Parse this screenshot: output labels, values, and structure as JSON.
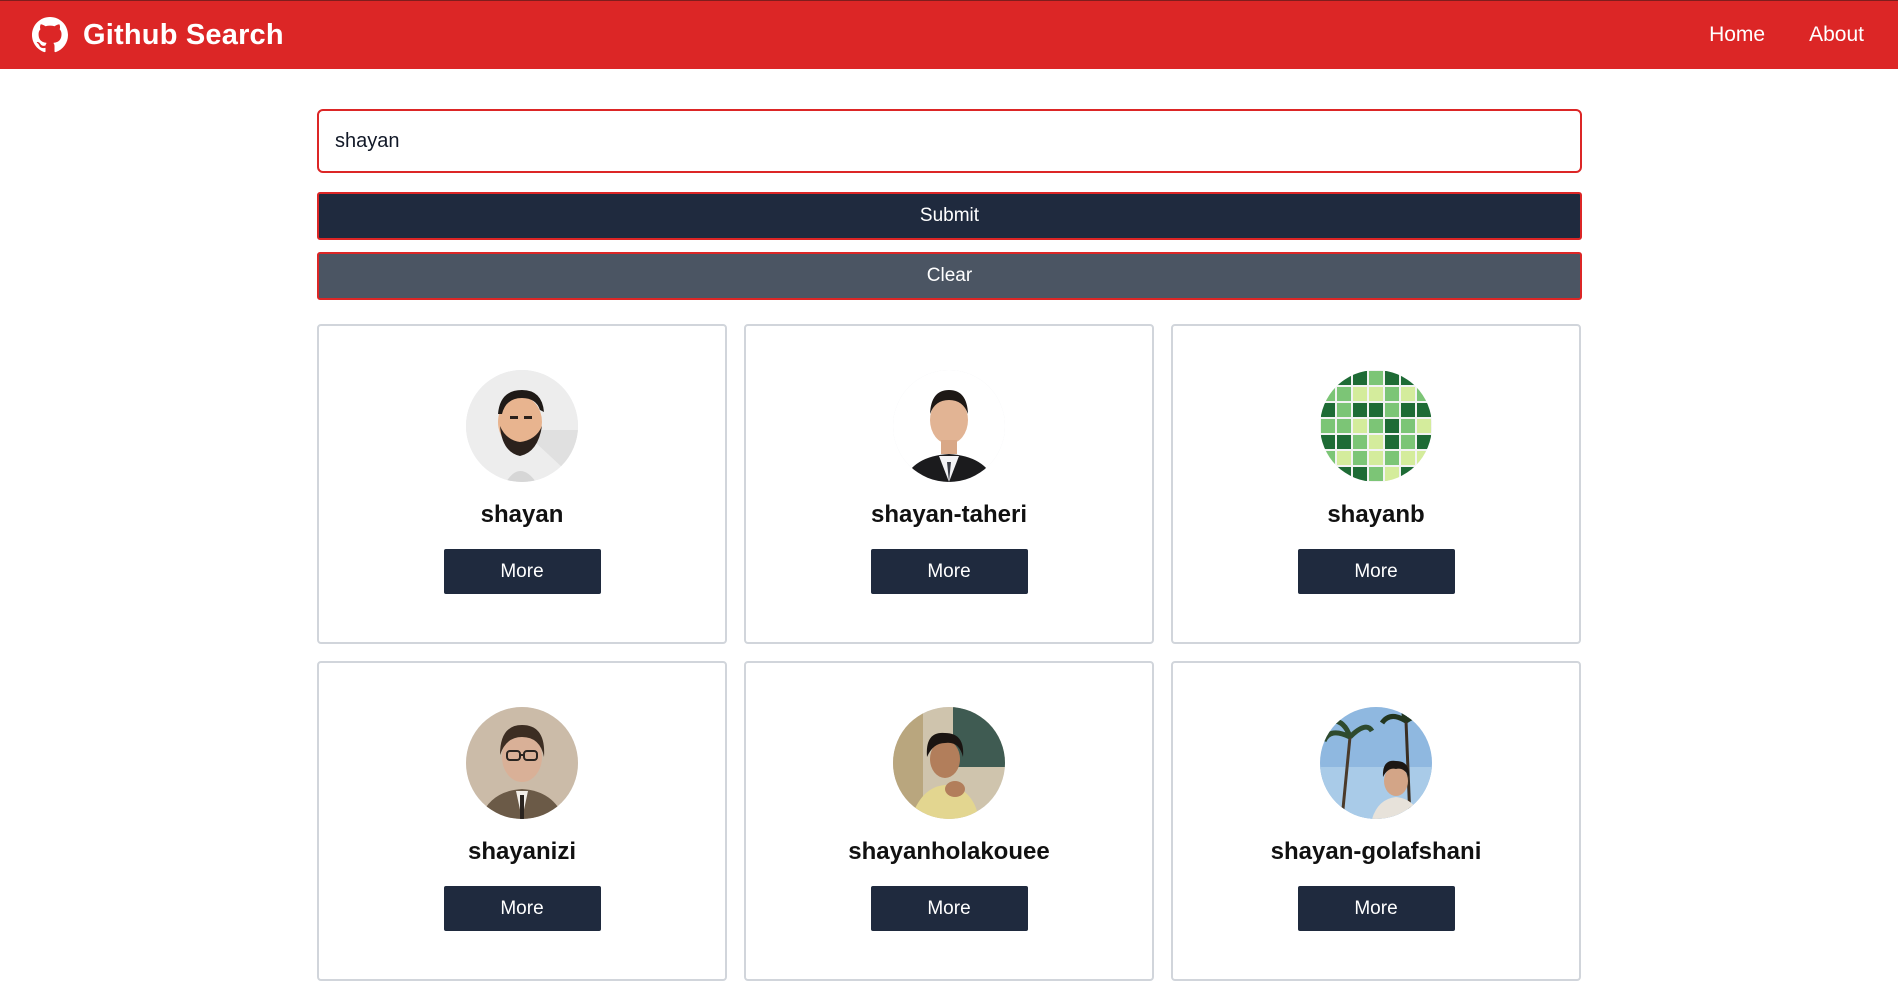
{
  "header": {
    "title": "Github Search",
    "logo_icon": "github-icon",
    "nav": [
      {
        "label": "Home"
      },
      {
        "label": "About"
      }
    ],
    "accent_color": "#dc2626"
  },
  "search": {
    "value": "shayan",
    "placeholder": "Search Users..."
  },
  "actions": {
    "submit_label": "Submit",
    "clear_label": "Clear"
  },
  "users": [
    {
      "login": "shayan",
      "more_label": "More",
      "avatar": "illustrated-bearded-man"
    },
    {
      "login": "shayan-taheri",
      "more_label": "More",
      "avatar": "portrait-suit"
    },
    {
      "login": "shayanb",
      "more_label": "More",
      "avatar": "identicon-green"
    },
    {
      "login": "shayanizi",
      "more_label": "More",
      "avatar": "portrait-glasses"
    },
    {
      "login": "shayanholakouee",
      "more_label": "More",
      "avatar": "portrait-dark"
    },
    {
      "login": "shayan-golafshani",
      "more_label": "More",
      "avatar": "portrait-palms"
    }
  ]
}
